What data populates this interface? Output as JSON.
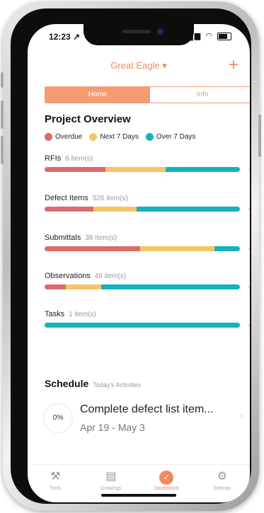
{
  "status": {
    "time": "12:23 ↗",
    "icons": "▮▮ ☰"
  },
  "header": {
    "project_title": "Great Eagle ▾",
    "add_label": "+"
  },
  "segment": {
    "home": "Home",
    "info": "Info"
  },
  "overview": {
    "title": "Project Overview",
    "legend": [
      {
        "label": "Overdue",
        "color": "#e0676b"
      },
      {
        "label": "Next 7 Days",
        "color": "#f5c567"
      },
      {
        "label": "Over 7 Days",
        "color": "#12b3bf"
      }
    ],
    "rows": [
      {
        "label": "RFIs",
        "count": "6 item(s)",
        "fractions": [
          0.31,
          0.31,
          0.38
        ]
      },
      {
        "label": "Defect Items",
        "count": "526 item(s)",
        "fractions": [
          0.25,
          0.22,
          0.53
        ]
      },
      {
        "label": "Submittals",
        "count": "38 Item(s)",
        "fractions": [
          0.49,
          0.38,
          0.13
        ]
      },
      {
        "label": "Observations",
        "count": "48 item(s)",
        "fractions": [
          0.11,
          0.18,
          0.71
        ]
      },
      {
        "label": "Tasks",
        "count": "1 item(s)",
        "fractions": [
          0,
          0,
          1
        ]
      }
    ]
  },
  "schedule": {
    "title": "Schedule",
    "subtitle": "Today's Activities",
    "activity": {
      "percent": "0%",
      "title": "Complete defect list item...",
      "date": "Apr 19 - May 3"
    }
  },
  "tabs": [
    {
      "label": "Tools",
      "icon": "toolbox-icon",
      "glyph": "⚒",
      "active": false
    },
    {
      "label": "Drawings",
      "icon": "drawings-icon",
      "glyph": "▤",
      "active": false
    },
    {
      "label": "Dashboard",
      "icon": "dashboard-icon",
      "glyph": "✓",
      "active": true
    },
    {
      "label": "Settings",
      "icon": "settings-icon",
      "glyph": "⚙",
      "active": false
    }
  ],
  "colors": {
    "accent": "#f08a5d",
    "overdue": "#e0676b",
    "next7": "#f5c567",
    "over7": "#12b3bf"
  }
}
